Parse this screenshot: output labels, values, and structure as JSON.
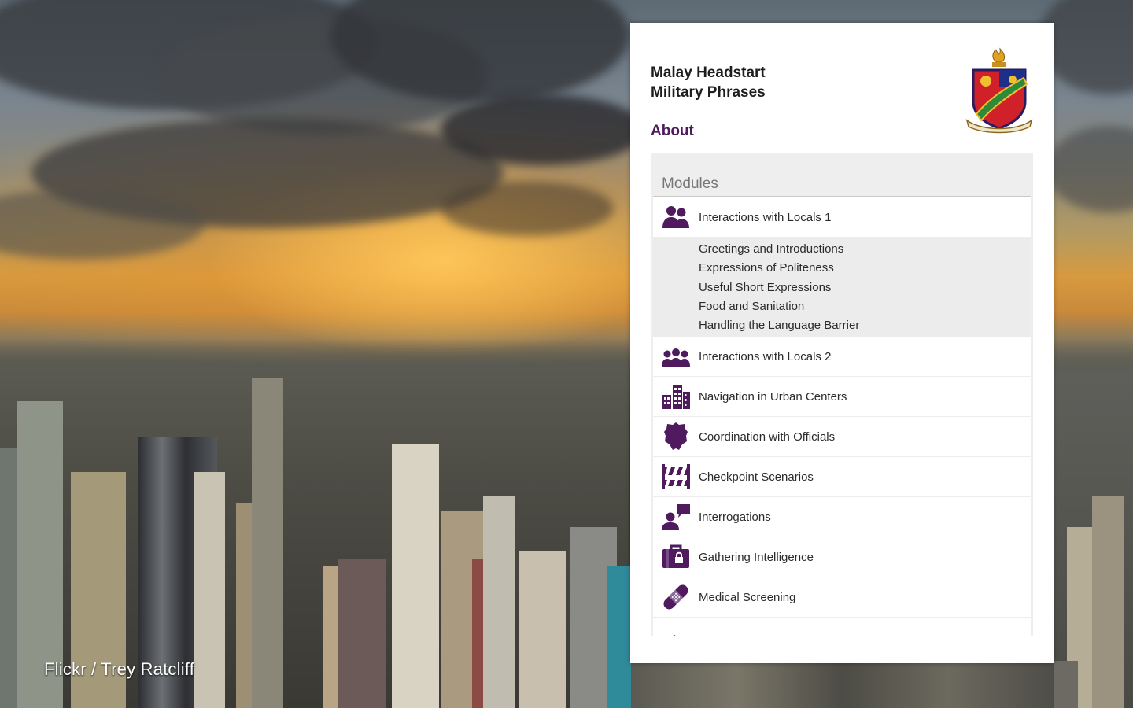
{
  "background": {
    "credit": "Flickr / Trey Ratcliff"
  },
  "app": {
    "title_line1": "Malay Headstart",
    "title_line2": "Military Phrases",
    "about": "About",
    "crest": "dli-crest-logo",
    "accent_color": "#4f1a5e"
  },
  "modules": {
    "header": "Modules",
    "items": [
      {
        "label": "Interactions with Locals 1",
        "icon": "two-people-icon",
        "expanded": true,
        "subitems": [
          "Greetings and Introductions",
          "Expressions of Politeness",
          "Useful Short Expressions",
          "Food and Sanitation",
          "Handling the Language Barrier"
        ]
      },
      {
        "label": "Interactions with Locals 2",
        "icon": "group-people-icon"
      },
      {
        "label": "Navigation in Urban Centers",
        "icon": "buildings-icon"
      },
      {
        "label": "Coordination with Officials",
        "icon": "police-badge-icon"
      },
      {
        "label": "Checkpoint Scenarios",
        "icon": "barrier-icon"
      },
      {
        "label": "Interrogations",
        "icon": "speech-person-icon"
      },
      {
        "label": "Gathering Intelligence",
        "icon": "briefcase-lock-icon"
      },
      {
        "label": "Medical Screening",
        "icon": "bandage-icon"
      }
    ]
  }
}
